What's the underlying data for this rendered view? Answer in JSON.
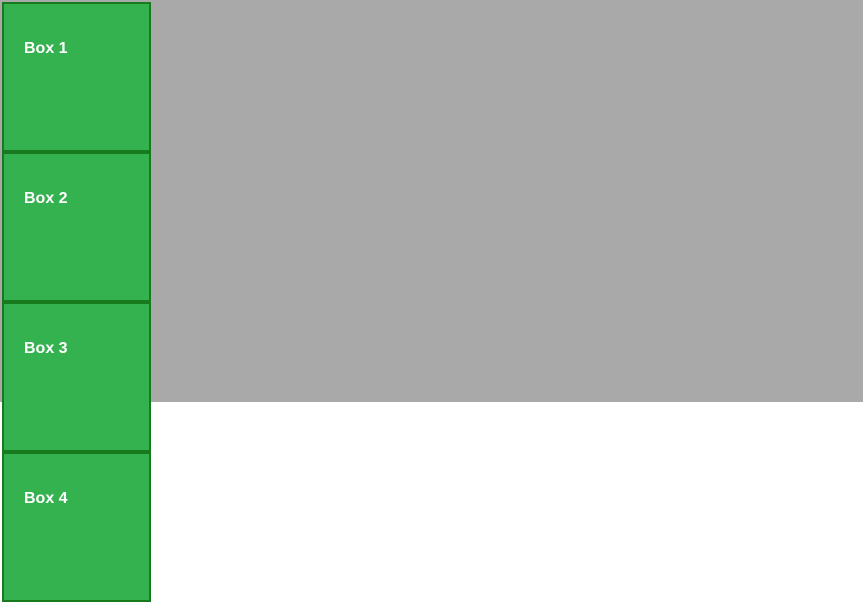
{
  "boxes": [
    {
      "label": "Box 1"
    },
    {
      "label": "Box 2"
    },
    {
      "label": "Box 3"
    },
    {
      "label": "Box 4"
    }
  ],
  "colors": {
    "container_bg": "#a9a9a9",
    "box_bg": "#34b24f",
    "box_border": "#177a1d",
    "box_text": "#ffffff"
  }
}
